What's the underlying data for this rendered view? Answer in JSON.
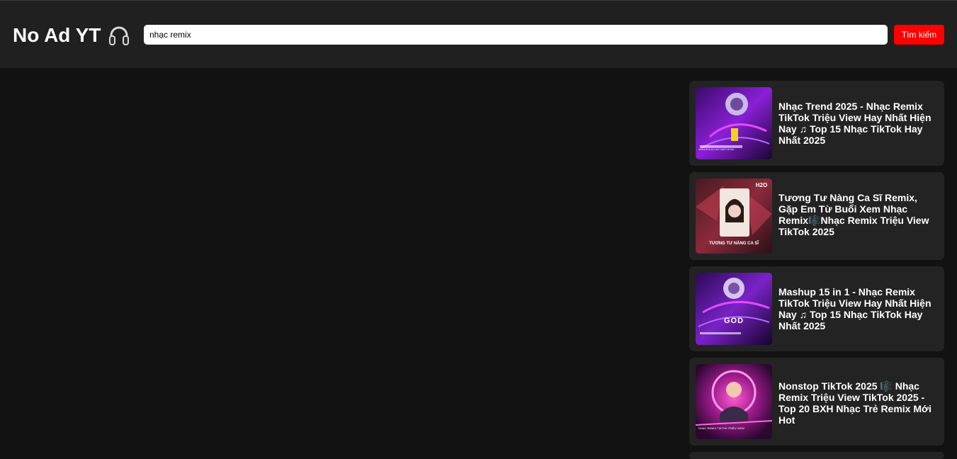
{
  "header": {
    "logo_text": "No Ad YT",
    "logo_icon": "headphones-icon"
  },
  "search": {
    "value": "nhạc remix",
    "button_label": "Tìm kiếm"
  },
  "results": [
    {
      "title": "Nhạc Trend 2025 - Nhạc Remix TikTok Triệu View Hay Nhất Hiện Nay ♫ Top 15 Nhạc TikTok Hay Nhất 2025",
      "thumbnail_caption": "MASHUP 15 IN 1 HAY NHẤT TIKTOK"
    },
    {
      "title": "Tương Tư Nàng Ca Sĩ Remix, Gặp Em Từ Buổi Xem Nhạc Remix🎼Nhạc Remix Triệu View TikTok 2025",
      "thumbnail_caption": "TƯƠNG TƯ NÀNG CA SĨ"
    },
    {
      "title": "Mashup 15 in 1 - Nhạc Remix TikTok Triệu View Hay Nhất Hiện Nay ♫ Top 15 Nhạc TikTok Hay Nhất 2025",
      "thumbnail_caption": "GOD"
    },
    {
      "title": "Nonstop TikTok 2025 🎼 Nhạc Remix Triệu View TikTok 2025 - Top 20 BXH Nhạc Trẻ Remix Mới Hot",
      "thumbnail_caption": "NHẠC REMIX TIKTOK TRIỆU VIEW"
    }
  ],
  "colors": {
    "page_bg": "#121212",
    "header_bg": "#202020",
    "card_bg": "#232323",
    "accent": "#ff0000"
  }
}
